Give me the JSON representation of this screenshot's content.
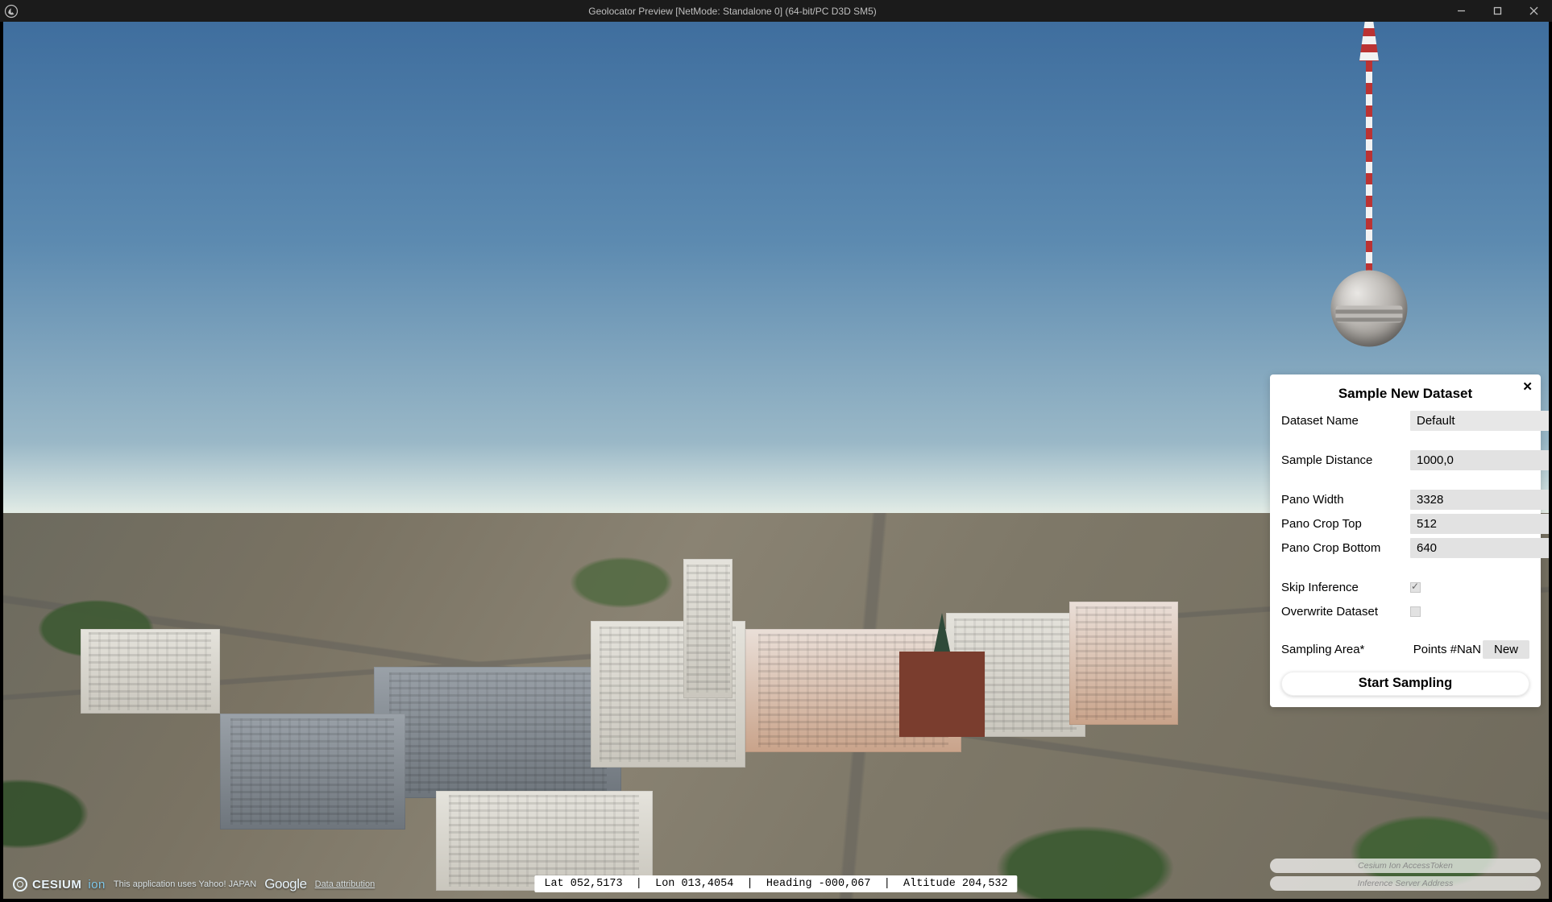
{
  "window": {
    "title": "Geolocator Preview [NetMode: Standalone 0]  (64-bit/PC D3D SM5)"
  },
  "status": {
    "lat_label": "Lat",
    "lat": "052,5173",
    "lon_label": "Lon",
    "lon": "013,4054",
    "heading_label": "Heading",
    "heading": "-000,067",
    "altitude_label": "Altitude",
    "altitude": "204,532"
  },
  "credits": {
    "cesium": "CESIUM",
    "cesium_ion": "ion",
    "yahoo_japan": "This application uses Yahoo! JAPAN",
    "google": "Google",
    "data_attribution": "Data attribution"
  },
  "config_inputs": {
    "cesium_token_placeholder": "Cesium Ion AccessToken",
    "inference_server_placeholder": "Inference Server Address"
  },
  "panel": {
    "title": "Sample New Dataset",
    "dataset_name_label": "Dataset Name",
    "dataset_name_value": "Default",
    "sample_distance_label": "Sample Distance",
    "sample_distance_value": "1000,0",
    "pano_width_label": "Pano Width",
    "pano_width_value": "3328",
    "pano_crop_top_label": "Pano Crop Top",
    "pano_crop_top_value": "512",
    "pano_crop_bottom_label": "Pano Crop Bottom",
    "pano_crop_bottom_value": "640",
    "skip_inference_label": "Skip Inference",
    "skip_inference_checked": true,
    "overwrite_dataset_label": "Overwrite Dataset",
    "overwrite_dataset_checked": false,
    "sampling_area_label": "Sampling Area*",
    "points_label": "Points #",
    "points_value": "NaN",
    "new_button": "New",
    "start_button": "Start Sampling"
  }
}
